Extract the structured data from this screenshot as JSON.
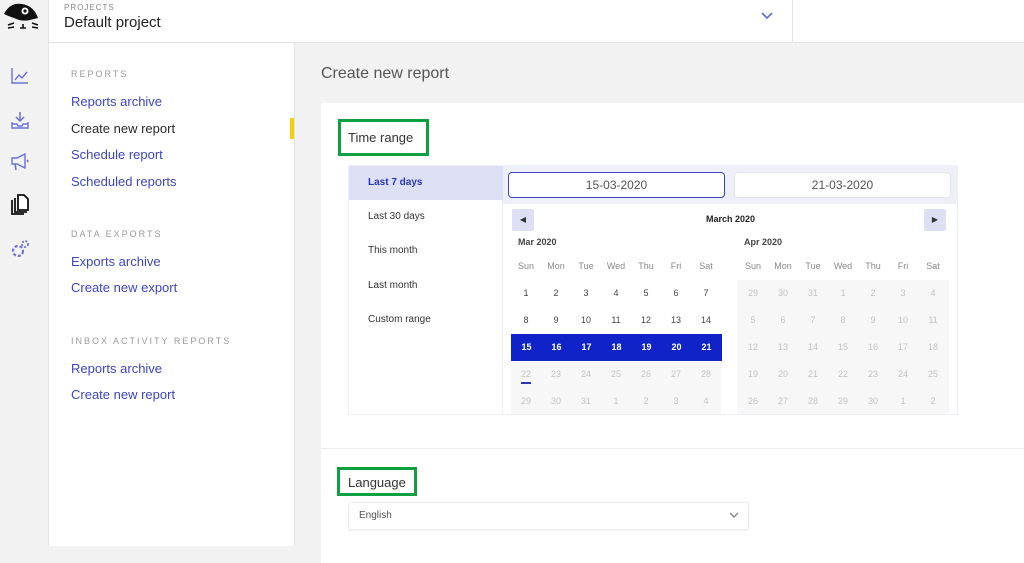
{
  "topbar": {
    "projects_label": "PROJECTS",
    "project_name": "Default project"
  },
  "icon_rail": [
    {
      "icon": "analytics-chart-icon",
      "active": false
    },
    {
      "icon": "download-tray-icon",
      "active": false
    },
    {
      "icon": "megaphone-icon",
      "active": false
    },
    {
      "icon": "reports-documents-icon",
      "active": true
    },
    {
      "icon": "settings-gears-icon",
      "active": false
    }
  ],
  "subnav": {
    "sections": [
      {
        "title": "REPORTS",
        "items": [
          {
            "label": "Reports archive",
            "active": false
          },
          {
            "label": "Create new report",
            "active": true
          },
          {
            "label": "Schedule report",
            "active": false
          },
          {
            "label": "Scheduled reports",
            "active": false
          }
        ]
      },
      {
        "title": "DATA EXPORTS",
        "items": [
          {
            "label": "Exports archive",
            "active": false
          },
          {
            "label": "Create new export",
            "active": false
          }
        ]
      },
      {
        "title": "INBOX ACTIVITY REPORTS",
        "items": [
          {
            "label": "Reports archive",
            "active": false
          },
          {
            "label": "Create new report",
            "active": false
          }
        ]
      }
    ]
  },
  "main": {
    "page_title": "Create new report",
    "time_range": {
      "label": "Time range",
      "presets": [
        "Last 7 days",
        "Last 30 days",
        "This month",
        "Last month",
        "Custom range"
      ],
      "selected_preset": "Last 7 days",
      "start_date": "15-03-2020",
      "end_date": "21-03-2020",
      "header_month": "March 2020",
      "weekdays": [
        "Sun",
        "Mon",
        "Tue",
        "Wed",
        "Thu",
        "Fri",
        "Sat"
      ],
      "left_month": {
        "name": "Mar 2020",
        "weeks": [
          [
            "1",
            "2",
            "3",
            "4",
            "5",
            "6",
            "7"
          ],
          [
            "8",
            "9",
            "10",
            "11",
            "12",
            "13",
            "14"
          ],
          [
            "15",
            "16",
            "17",
            "18",
            "19",
            "20",
            "21"
          ],
          [
            "22",
            "23",
            "24",
            "25",
            "26",
            "27",
            "28"
          ],
          [
            "29",
            "30",
            "31",
            "1",
            "2",
            "3",
            "4"
          ]
        ]
      },
      "right_month": {
        "name": "Apr 2020",
        "weeks": [
          [
            "29",
            "30",
            "31",
            "1",
            "2",
            "3",
            "4"
          ],
          [
            "5",
            "6",
            "7",
            "8",
            "9",
            "10",
            "11"
          ],
          [
            "12",
            "13",
            "14",
            "15",
            "16",
            "17",
            "18"
          ],
          [
            "19",
            "20",
            "21",
            "22",
            "23",
            "24",
            "25"
          ],
          [
            "26",
            "27",
            "28",
            "29",
            "30",
            "1",
            "2"
          ]
        ]
      },
      "selected_range_days": [
        "15",
        "16",
        "17",
        "18",
        "19",
        "20",
        "21"
      ],
      "today": "22"
    },
    "language": {
      "label": "Language",
      "selected": "English"
    }
  },
  "colors": {
    "accent": "#3d45c0",
    "range_fill": "#0f23c8",
    "active_indicator": "#f5d10a",
    "highlight_box": "#0da040"
  }
}
